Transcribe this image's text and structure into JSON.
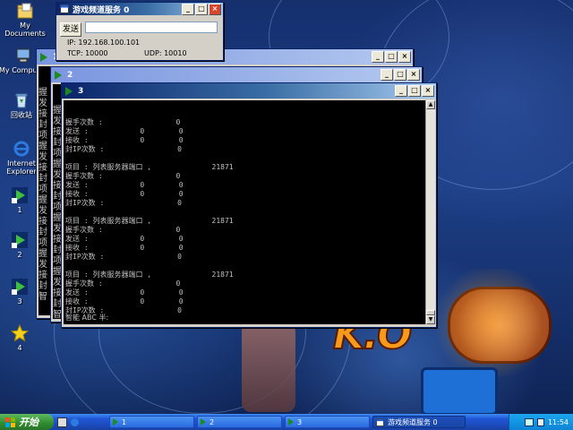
{
  "desktop": {
    "icons": [
      {
        "label": "My Documents"
      },
      {
        "label": "My Computer"
      },
      {
        "label": "回收站"
      },
      {
        "label": "Internet Explorer"
      },
      {
        "label": "1"
      },
      {
        "label": "2"
      },
      {
        "label": "3"
      },
      {
        "label": "4"
      }
    ],
    "wallpaper_text": "K.O"
  },
  "server_window": {
    "title": "游戏频道服务 0",
    "send_label": "发送",
    "input_value": "",
    "ip_line": "IP: 192.168.100.101",
    "tcp_line": "TCP: 10000",
    "udp_line": "UDP: 10010"
  },
  "window1": {
    "title": "1",
    "side_lines": [
      "握",
      "发",
      "接",
      "封",
      "项",
      "握",
      "发",
      "接",
      "封",
      "项",
      "握",
      "发",
      "接",
      "封",
      "项",
      "握",
      "发",
      "接",
      "封",
      "智"
    ]
  },
  "window2": {
    "title": "2",
    "side_lines": [
      "握",
      "发",
      "接",
      "封",
      "项",
      "握",
      "发",
      "接",
      "封",
      "项",
      "握",
      "发",
      "接",
      "封",
      "项",
      "握",
      "发",
      "接",
      "封",
      "智"
    ]
  },
  "window3": {
    "title": "3",
    "lines": [
      "握手次数 :                 0",
      "发送 :            0        0",
      "接收 :            0        0",
      "封IP次数 :                 0",
      "",
      "项目 : 列表服务器端口 ,              21871",
      "握手次数 :                 0",
      "发送 :            0        0",
      "接收 :            0        0",
      "封IP次数 :                 0",
      "",
      "项目 : 列表服务器端口 ,              21871",
      "握手次数 :                 0",
      "发送 :            0        0",
      "接收 :            0        0",
      "封IP次数 :                 0",
      "",
      "项目 : 列表服务器端口 ,              21871",
      "握手次数 :                 0",
      "发送 :            0        0",
      "接收 :            0        0",
      "封IP次数 :                 0"
    ],
    "ime_line": "智能 ABC 半:"
  },
  "taskbar": {
    "start_label": "开始",
    "items": [
      {
        "label": "1"
      },
      {
        "label": "2"
      },
      {
        "label": "3"
      },
      {
        "label": "游戏频道服务 0"
      }
    ],
    "clock": "11:54"
  }
}
